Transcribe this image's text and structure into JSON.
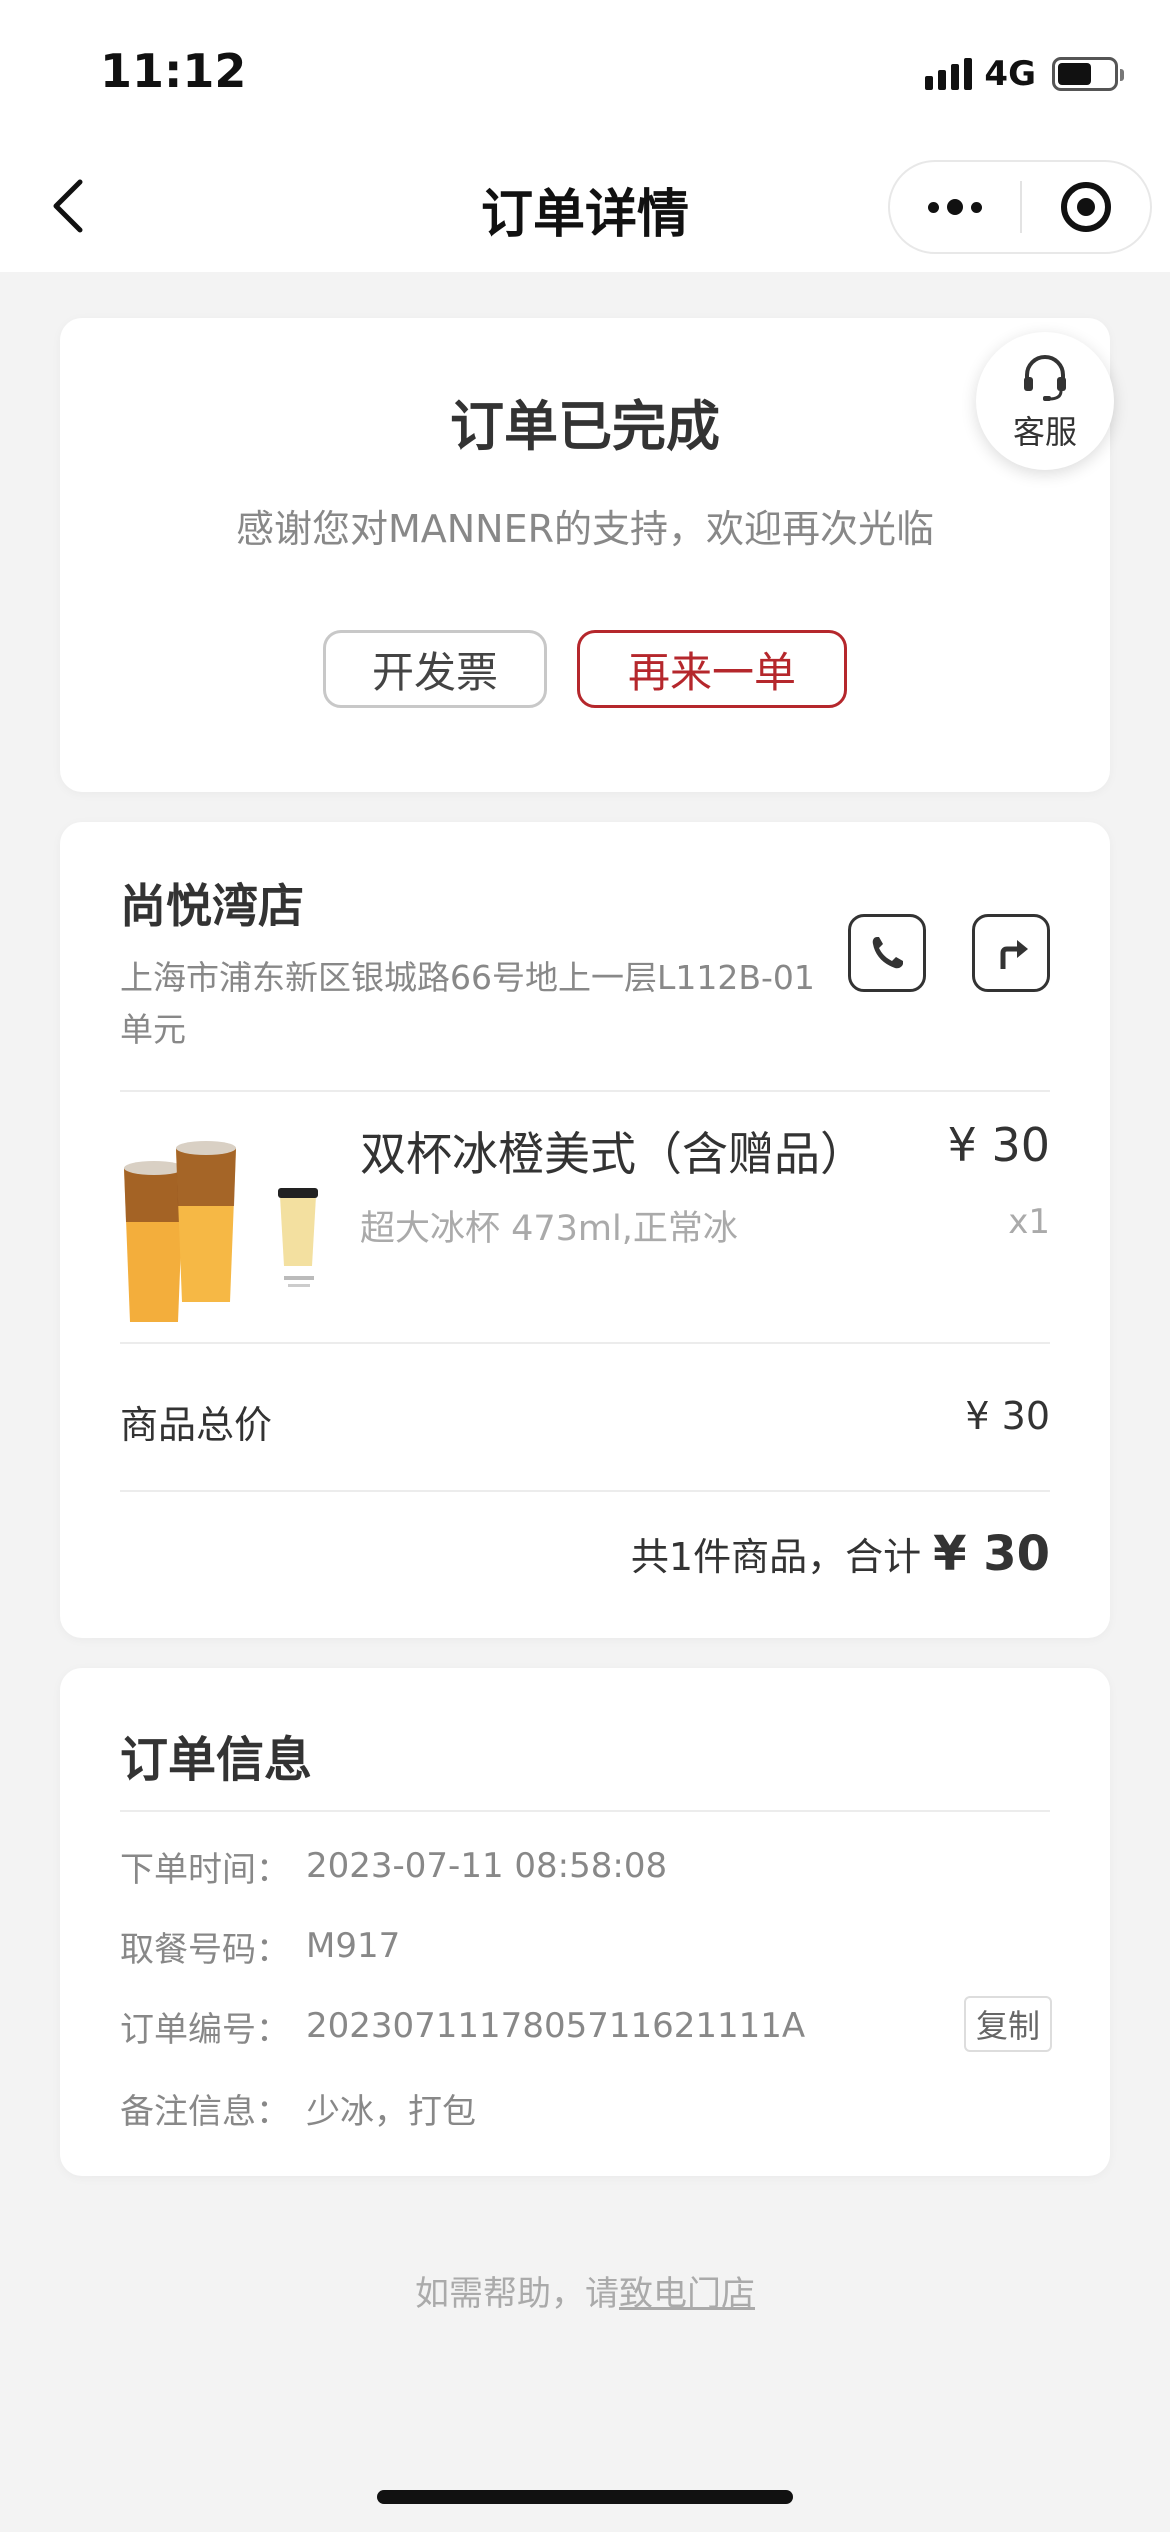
{
  "status_bar": {
    "time": "11:12",
    "network": "4G",
    "battery_level": 0.62
  },
  "nav": {
    "title": "订单详情"
  },
  "order_status": {
    "title": "订单已完成",
    "subtitle": "感谢您对MANNER的支持，欢迎再次光临",
    "invoice_label": "开发票",
    "reorder_label": "再来一单",
    "service_label": "客服"
  },
  "store": {
    "name": "尚悦湾店",
    "address": "上海市浦东新区银城路66号地上一层L112B-01单元"
  },
  "product": {
    "name": "双杯冰橙美式（含赠品）",
    "spec": "超大冰杯 473ml,正常冰",
    "price": "¥ 30",
    "quantity": "x1"
  },
  "summary": {
    "subtotal_label": "商品总价",
    "subtotal_value": "¥ 30",
    "total_text": "共1件商品，合计",
    "total_value": "¥ 30"
  },
  "order_info": {
    "title": "订单信息",
    "rows": [
      {
        "key": "下单时间：",
        "value": "2023-07-11 08:58:08"
      },
      {
        "key": "取餐号码：",
        "value": "M917"
      },
      {
        "key": "订单编号：",
        "value": "2023071117805711621111A"
      },
      {
        "key": "备注信息：",
        "value": "少冰，打包"
      }
    ],
    "copy_label": "复制"
  },
  "footer": {
    "help_text": "如需帮助，请",
    "help_link": "致电门店"
  },
  "colors": {
    "accent": "#b5272c",
    "background": "#f3f3f3",
    "card": "#ffffff"
  }
}
